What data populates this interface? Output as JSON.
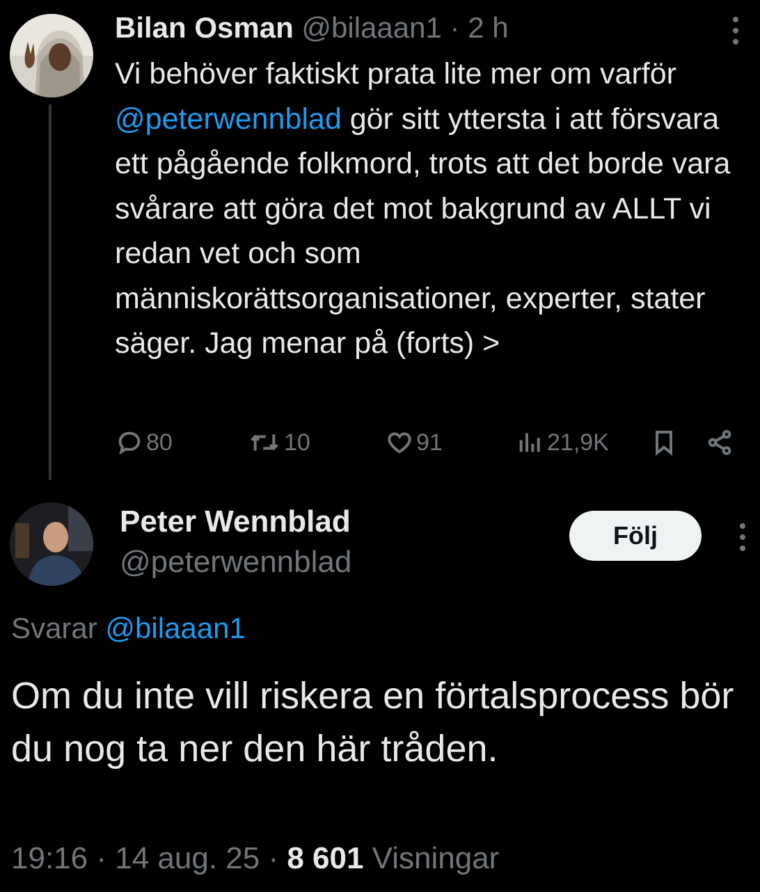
{
  "tweet1": {
    "author_name": "Bilan Osman",
    "handle": "@bilaaan1",
    "separator": "·",
    "time_ago": "2 h",
    "text_part1": "Vi behöver faktiskt prata lite mer om varför ",
    "mention": "@peterwennblad",
    "text_part2": " gör sitt yttersta i att försvara ett pågående folkmord, trots att det borde vara svårare att göra det mot bakgrund av ALLT vi redan vet och som människorättsorganisationer, experter, stater säger. Jag menar på (forts) >",
    "stats": {
      "replies": "80",
      "retweets": "10",
      "likes": "91",
      "views": "21,9K"
    },
    "icons": [
      "reply-icon",
      "retweet-icon",
      "like-icon",
      "views-icon",
      "bookmark-icon",
      "share-icon",
      "more-icon"
    ]
  },
  "tweet2": {
    "author_name": "Peter Wennblad",
    "handle": "@peterwennblad",
    "follow_label": "Följ",
    "reply_prefix": "Svarar",
    "reply_mention": "@bilaaan1",
    "text": "Om du inte vill riskera en förtalsprocess bör du nog ta ner den här tråden.",
    "time": "19:16",
    "separator": "·",
    "date": "14 aug. 25",
    "views_count": "8 601",
    "views_label": "Visningar"
  },
  "colors": {
    "background": "#000000",
    "text": "#e7e9ea",
    "muted": "#71767b",
    "link": "#1d9bf0",
    "button_bg": "#eff3f4"
  }
}
